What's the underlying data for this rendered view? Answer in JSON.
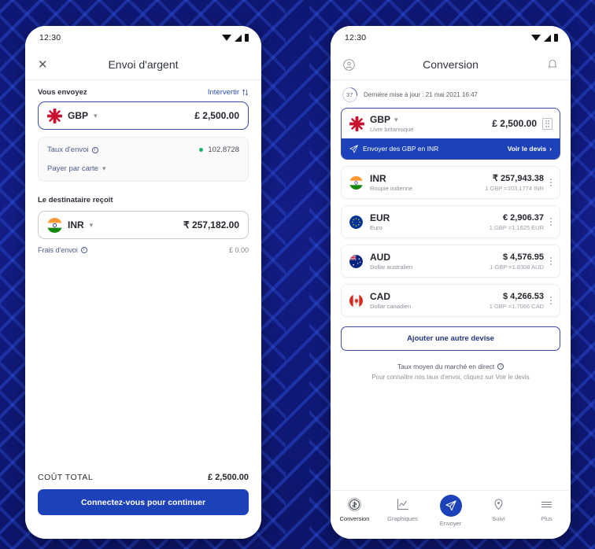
{
  "background": {
    "color": "#10197a",
    "accent": "#1c41b8"
  },
  "left_phone": {
    "status": {
      "time": "12:30",
      "wifi_icon": "wifi-icon",
      "signal_icon": "signal-icon",
      "battery_icon": "battery-icon"
    },
    "appbar": {
      "close_icon": "close-icon",
      "title": "Envoi d'argent"
    },
    "send": {
      "label": "Vous envoyez",
      "swap_label": "Intervertir",
      "swap_icon": "swap-arrows-icon",
      "currency_code": "GBP",
      "currency_flag": "gb-flag-icon",
      "amount": "£ 2,500.00"
    },
    "rate_card": {
      "rate_label": "Taux d'envoi",
      "rate_info_icon": "info-icon",
      "rate_value": "102.8728",
      "rate_dot_color": "#17b26a",
      "pay_method": "Payer par carte",
      "pay_chevron_icon": "chevron-down-icon"
    },
    "receive": {
      "label": "Le destinataire reçoit",
      "currency_code": "INR",
      "currency_flag": "in-flag-icon",
      "amount": "₹ 257,182.00"
    },
    "fee": {
      "label": "Frais d'envoi",
      "info_icon": "info-icon",
      "value": "£ 0.00"
    },
    "total": {
      "label": "COÛT TOTAL",
      "value": "£ 2,500.00"
    },
    "cta": {
      "label": "Connectez-vous pour continuer"
    }
  },
  "right_phone": {
    "status": {
      "time": "12:30",
      "wifi_icon": "wifi-icon",
      "signal_icon": "signal-icon",
      "battery_icon": "battery-icon"
    },
    "appbar": {
      "profile_icon": "account-circle-icon",
      "title": "Conversion",
      "bell_icon": "notification-bell-icon"
    },
    "update": {
      "countdown": "37",
      "text": "Dernière mise à jour : 21 mai 2021 16:47"
    },
    "base": {
      "currency_code": "GBP",
      "currency_name": "Livre britannique",
      "currency_flag": "gb-flag-icon",
      "amount": "£ 2,500.00",
      "chevron_icon": "chevron-down-icon",
      "keypad_icon": "keypad-icon",
      "banner_text": "Envoyer des GBP en INR",
      "banner_icon": "send-plane-icon",
      "banner_cta": "Voir le devis",
      "banner_cta_icon": "chevron-right-icon"
    },
    "currencies": [
      {
        "code": "INR",
        "name": "Roupie indienne",
        "flag": "in-flag-icon",
        "amount": "₹ 257,943.38",
        "rate": "1 GBP =103.1774 INR",
        "menu_icon": "kebab-menu-icon"
      },
      {
        "code": "EUR",
        "name": "Euro",
        "flag": "eu-flag-icon",
        "amount": "€ 2,906.37",
        "rate": "1 GBP =1.1625 EUR",
        "menu_icon": "kebab-menu-icon"
      },
      {
        "code": "AUD",
        "name": "Dollar australien",
        "flag": "au-flag-icon",
        "amount": "$ 4,576.95",
        "rate": "1 GBP =1.8308 AUD",
        "menu_icon": "kebab-menu-icon"
      },
      {
        "code": "CAD",
        "name": "Dollar canadien",
        "flag": "ca-flag-icon",
        "amount": "$ 4,266.53",
        "rate": "1 GBP =1.7066 CAD",
        "menu_icon": "kebab-menu-icon"
      }
    ],
    "add_button": {
      "label": "Ajouter une autre devise"
    },
    "footer": {
      "line1": "Taux moyen du marché en direct",
      "line1_info_icon": "info-icon",
      "line2": "Pour connaître nos taux d'envoi, cliquez sur Voir le devis"
    },
    "bottom_nav": [
      {
        "label": "Conversion",
        "icon": "coin-dollar-icon",
        "active": true
      },
      {
        "label": "Graphiques",
        "icon": "line-chart-icon",
        "active": false
      },
      {
        "label": "Envoyer",
        "icon": "send-plane-icon",
        "active": false
      },
      {
        "label": "Suivi",
        "icon": "map-pin-icon",
        "active": false
      },
      {
        "label": "Plus",
        "icon": "hamburger-menu-icon",
        "active": false
      }
    ]
  }
}
